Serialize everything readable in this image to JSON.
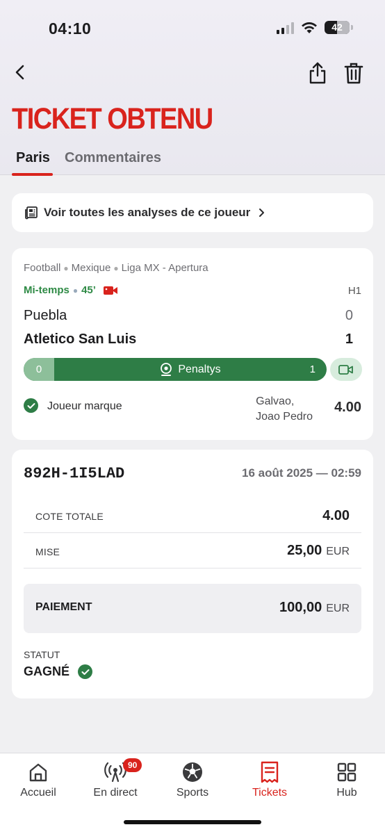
{
  "status_bar": {
    "time": "04:10",
    "battery": "42"
  },
  "header": {
    "title": "TICKET OBTENU",
    "tabs": [
      {
        "label": "Paris",
        "active": true
      },
      {
        "label": "Commentaires",
        "active": false
      }
    ]
  },
  "analyses": {
    "label": "Voir toutes les analyses de ce joueur"
  },
  "match": {
    "sport": "Football",
    "country": "Mexique",
    "league": "Liga MX - Apertura",
    "status": "Mi-temps",
    "minute": "45’",
    "period": "H1",
    "home_team": "Puebla",
    "home_score": "0",
    "away_team": "Atletico San Luis",
    "away_score": "1",
    "penalties": {
      "label": "Penaltys",
      "home": "0",
      "away": "1"
    },
    "selection": {
      "market": "Joueur marque",
      "player_line1": "Galvao,",
      "player_line2": "Joao Pedro",
      "odd": "4.00"
    }
  },
  "ticket": {
    "id": "892H-1I5LAD",
    "date": "16 août 2025 — 02:59",
    "total_odds_label": "COTE TOTALE",
    "total_odds": "4.00",
    "stake_label": "MISE",
    "stake": "25,00",
    "currency": "EUR",
    "payout_label": "PAIEMENT",
    "payout": "100,00",
    "status_label": "STATUT",
    "status": "GAGNÉ"
  },
  "tabbar": {
    "items": [
      {
        "label": "Accueil",
        "icon": "home-icon"
      },
      {
        "label": "En direct",
        "icon": "live-icon",
        "badge": "90"
      },
      {
        "label": "Sports",
        "icon": "soccer-ball-icon"
      },
      {
        "label": "Tickets",
        "icon": "ticket-icon",
        "active": true
      },
      {
        "label": "Hub",
        "icon": "grid-icon"
      }
    ]
  },
  "colors": {
    "brand_red": "#d9231d",
    "win_green": "#2e7d46",
    "live_green": "#2e8a45"
  }
}
